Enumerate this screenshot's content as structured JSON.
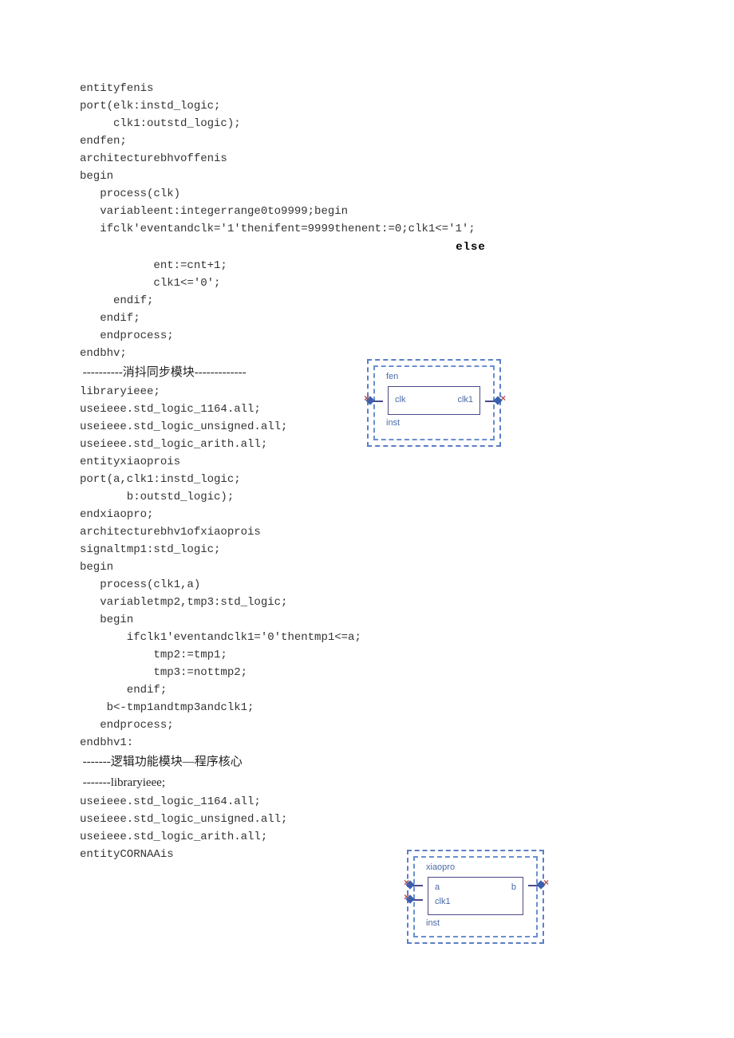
{
  "code1": [
    "entityfenis",
    "port(elk:instd_logic;",
    "     clk1:outstd_logic);",
    "endfen;",
    "architecturebhvoffenis",
    "begin",
    "   process(clk)",
    "   variableent:integerrange0to9999;begin",
    "   ifclk'eventandclk='1'thenifent=9999thenent:=0;clk1<='1';"
  ],
  "else_word": "else",
  "code2": [
    "           ent:=cnt+1;",
    "           clk1<='0';",
    "     endif;",
    "   endif;",
    "   endprocess;",
    "endbhv;"
  ],
  "heading1": " ----------消抖同步模块-------------",
  "code3": [
    "libraryieee;",
    "useieee.std_logic_1164.all;",
    "useieee.std_logic_unsigned.all;",
    "useieee.std_logic_arith.all;",
    "entityxiaoprois",
    "port(a,clk1:instd_logic;",
    "       b:outstd_logic);",
    "endxiaopro;",
    "architecturebhv1ofxiaoprois",
    "signaltmp1:std_logic;",
    "begin",
    "   process(clk1,a)",
    "   variabletmp2,tmp3:std_logic;",
    "   begin",
    "       ifclk1'eventandclk1='0'thentmp1<=a;",
    "           tmp2:=tmp1;",
    "           tmp3:=nottmp2;",
    "       endif;",
    "    b<-tmp1andtmp3andclk1;",
    "   endprocess;",
    "endbhv1:"
  ],
  "heading2a": " -------逻辑功能模块—程序核心",
  "heading2b": " -------libraryieee;",
  "code4": [
    "useieee.std_logic_1164.all;",
    "useieee.std_logic_unsigned.all;",
    "useieee.std_logic_arith.all;",
    "entityCORNAAis"
  ],
  "diagram1": {
    "module": "fen",
    "inst": "inst",
    "port_in": "clk",
    "port_out": "clk1"
  },
  "diagram2": {
    "module": "xiaopro",
    "inst": "inst",
    "port_in1": "a",
    "port_in2": "clk1",
    "port_out": "b"
  }
}
